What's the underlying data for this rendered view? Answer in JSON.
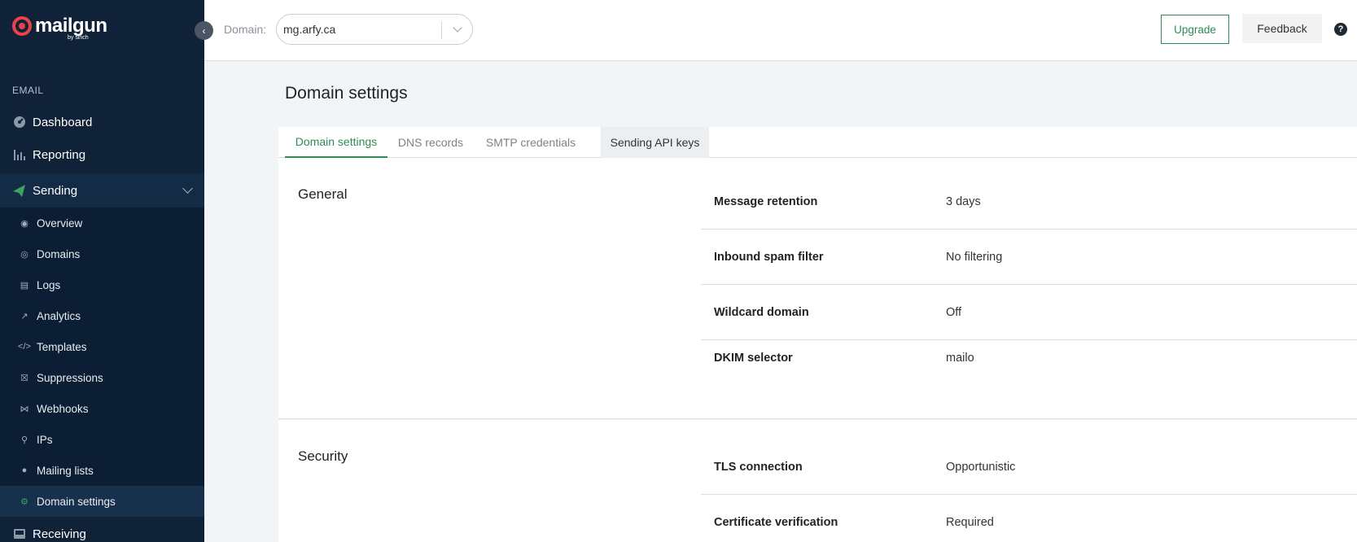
{
  "brand": {
    "name": "mailgun",
    "byline": "by sinch"
  },
  "sidebar": {
    "section_label": "EMAIL",
    "top_items": [
      {
        "label": "Dashboard",
        "icon": "dashboard-icon"
      },
      {
        "label": "Reporting",
        "icon": "bar-chart-icon"
      },
      {
        "label": "Sending",
        "icon": "paper-plane-icon"
      }
    ],
    "sending_items": [
      {
        "label": "Overview",
        "icon": "eye-icon"
      },
      {
        "label": "Domains",
        "icon": "globe-icon"
      },
      {
        "label": "Logs",
        "icon": "document-icon"
      },
      {
        "label": "Analytics",
        "icon": "trend-icon"
      },
      {
        "label": "Templates",
        "icon": "code-icon"
      },
      {
        "label": "Suppressions",
        "icon": "block-icon"
      },
      {
        "label": "Webhooks",
        "icon": "webhook-icon"
      },
      {
        "label": "IPs",
        "icon": "pin-icon"
      },
      {
        "label": "Mailing lists",
        "icon": "person-icon"
      },
      {
        "label": "Domain settings",
        "icon": "gear-icon",
        "active": true
      }
    ],
    "receiving": {
      "label": "Receiving",
      "icon": "inbox-icon"
    }
  },
  "header": {
    "domain_label": "Domain:",
    "domain_value": "mg.arfy.ca",
    "upgrade_label": "Upgrade",
    "feedback_label": "Feedback",
    "help_glyph": "?"
  },
  "main": {
    "title": "Domain settings",
    "tabs": [
      {
        "label": "Domain settings",
        "active": true
      },
      {
        "label": "DNS records"
      },
      {
        "label": "SMTP credentials"
      },
      {
        "label": "Sending API keys",
        "highlighted": true
      }
    ],
    "general": {
      "title": "General",
      "rows": [
        {
          "key": "Message retention",
          "value": "3 days"
        },
        {
          "key": "Inbound spam filter",
          "value": "No filtering"
        },
        {
          "key": "Wildcard domain",
          "value": "Off"
        },
        {
          "key": "DKIM selector",
          "value": "mailo"
        }
      ]
    },
    "security": {
      "title": "Security",
      "rows": [
        {
          "key": "TLS connection",
          "value": "Opportunistic"
        },
        {
          "key": "Certificate verification",
          "value": "Required"
        }
      ]
    }
  },
  "colors": {
    "sidebar_bg": "#0f2238",
    "accent_green": "#2e8b57",
    "brand_red": "#e8434b"
  }
}
